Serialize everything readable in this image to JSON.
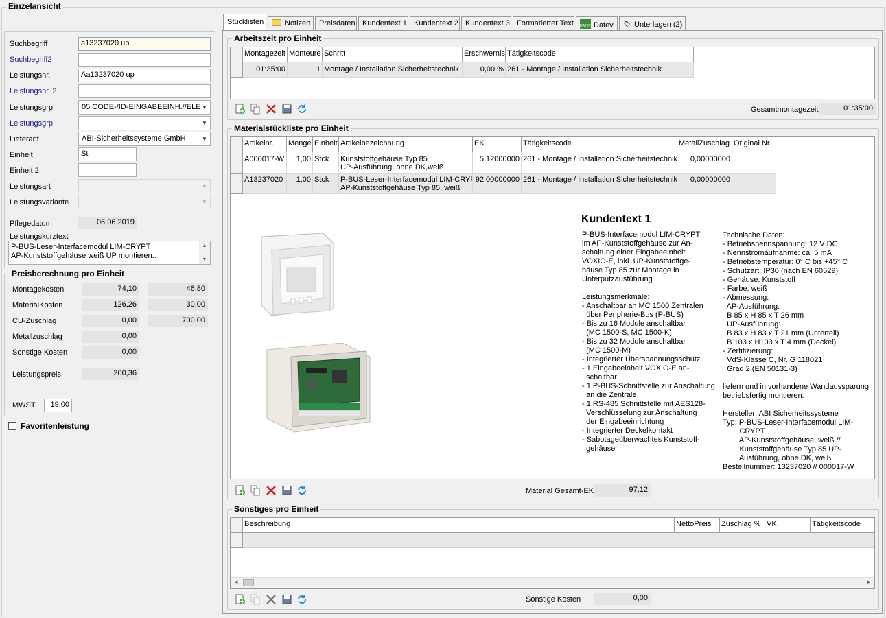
{
  "window": {
    "group_title": "Einzelansicht"
  },
  "form": {
    "suchbegriff_label": "Suchbegriff",
    "suchbegriff_value": "a13237020 up",
    "suchbegriff2_label": "Suchbegriff2",
    "suchbegriff2_value": "",
    "leistungsnr_label": "Leistungsnr.",
    "leistungsnr_value": "Aa13237020 up",
    "leistungsnr2_label": "Leistungsnr. 2",
    "leistungsnr2_value": "",
    "leistungsgrp_label": "Leistungsgrp.",
    "leistungsgrp_value": "05 CODE-/ID-EINGABEEINH.//ELE",
    "leistungsgrp2_label": "Leistungsgrp.",
    "leistungsgrp2_value": "",
    "lieferant_label": "Lieferant",
    "lieferant_value": "ABI-Sicherheitssysteme GmbH",
    "einheit_label": "Einheit",
    "einheit_value": "St",
    "einheit2_label": "Einheit 2",
    "einheit2_value": "",
    "leistungsart_label": "Leistungsart",
    "leistungsart_value": "",
    "leistungsvariante_label": "Leistungsvariante",
    "leistungsvariante_value": "",
    "pflegedatum_label": "Pflegedatum",
    "pflegedatum_value": "06.06.2019",
    "kurztext_label": "Leistungskurztext",
    "kurztext_line1": "P-BUS-Leser-Interfacemodul LIM-CRYPT",
    "kurztext_line2": "AP-Kunststoffgehäuse weiß UP montieren.."
  },
  "preis": {
    "title": "Preisberechnung pro Einheit",
    "montage_label": "Montagekosten",
    "montage_value": "74,10",
    "montage_value2": "46,80",
    "material_label": "MaterialKosten",
    "material_value": "126,26",
    "material_value2": "30,00",
    "cu_label": "CU-Zuschlag",
    "cu_value": "0,00",
    "cu_value2": "700,00",
    "metall_label": "Metallzuschlag",
    "metall_value": "0,00",
    "sonstige_label": "Sonstige Kosten",
    "sonstige_value": "0,00",
    "leistungspreis_label": "Leistungspreis",
    "leistungspreis_value": "200,36",
    "mwst_label": "MWST",
    "mwst_value": "19,00"
  },
  "favoriten_label": "Favoritenleistung",
  "tabs": [
    {
      "label": "Stücklisten"
    },
    {
      "label": "Notizen"
    },
    {
      "label": "Preisdaten"
    },
    {
      "label": "Kundentext 1"
    },
    {
      "label": "Kundentext 2"
    },
    {
      "label": "Kundentext 3"
    },
    {
      "label": "Formatierter Text"
    },
    {
      "label": "Datev"
    },
    {
      "label": "Unterlagen (2)"
    }
  ],
  "arbeitszeit": {
    "title": "Arbeitszeit pro Einheit",
    "headers": [
      "Montagezeit",
      "Monteure",
      "Schritt",
      "Erschwernis",
      "Tätigkeitscode"
    ],
    "row": [
      "01:35:00",
      "1",
      "Montage / Installation Sicherheitstechnik",
      "0,00 %",
      "261 - Montage / Installation Sicherheitstechnik"
    ],
    "gesamt_label": "Gesamtmontagezeit",
    "gesamt_value": "01:35:00"
  },
  "material": {
    "title": "Materialstückliste pro Einheit",
    "headers": [
      "Artikelnr.",
      "Menge",
      "Einheit",
      "Artikelbezeichnung",
      "EK",
      "Tätigkeitscode",
      "MetallZuschlag",
      "Original Nr."
    ],
    "rows": [
      {
        "artnr": "A000017-W",
        "menge": "1,00",
        "einheit": "Stck",
        "bez1": "Kunststoffgehäuse Typ 85",
        "bez2": "UP-Ausführung, ohne DK,weiß",
        "ek": "5,12000000",
        "code": "261 - Montage / Installation Sicherheitstechnik",
        "metall": "0,00000000",
        "orig": ""
      },
      {
        "artnr": "A13237020",
        "menge": "1,00",
        "einheit": "Stck",
        "bez1": "P-BUS-Leser-Interfacemodul LIM-CRYPT",
        "bez2": "AP-Kunststoffgehäuse Typ 85, weiß",
        "ek": "92,00000000",
        "code": "261 - Montage / Installation Sicherheitstechnik",
        "metall": "0,00000000",
        "orig": ""
      }
    ],
    "gesamt_label": "Material Gesamt-EK",
    "gesamt_value": "97,12"
  },
  "kundentext": {
    "heading": "Kundentext 1",
    "col1": [
      "P-BUS-Interfacemodul LIM-CRYPT",
      "im AP-Kunststoffgehäuse zur An-",
      "schaltung einer Eingabeeinheit",
      "VOXIO-E, inkl. UP-Kunststoffge-",
      "häuse Typ 85 zur Montage in",
      "Unterputzausführung",
      "",
      "Leistungsmerkmale:",
      "- Anschaltbar an MC 1500 Zentralen",
      "  über Peripherie-Bus (P-BUS)",
      "- Bis zu 16 Module anschaltbar",
      "  (MC 1500-S, MC 1500-K)",
      "- Bis zu 32 Module anschaltbar",
      "  (MC 1500-M)",
      "- Integrierter Überspannungsschutz",
      "- 1 Eingabeeinheit VOXIO-E an-",
      "  schaltbar",
      "- 1 P-BUS-Schnittstelle zur Anschaltung",
      "  an die Zentrale",
      "- 1 RS-485 Schnittstelle mit AES128-",
      "  Verschlüsselung zur Anschaltung",
      "  der Eingabeeinrichtung",
      "- Integrierter Deckelkontakt",
      "- Sabotageüberwachtes Kunststoff-",
      "  gehäuse"
    ],
    "col2": [
      "Technische Daten:",
      "- Betriebsnennspannung: 12 V DC",
      "- Nennstromaufnahme: ca. 5 mA",
      "- Betriebstemperatur: 0° C bis +45° C",
      "- Schutzart: IP30 (nach EN 60529)",
      "- Gehäuse: Kunststoff",
      "- Farbe: weiß",
      "- Abmessung:",
      "  AP-Ausführung:",
      "  B 85 x H 85 x T 26 mm",
      "  UP-Ausführung:",
      "  B 83 x H 83 x T 21 mm (Unterteil)",
      "  B 103 x H103 x T 4 mm (Deckel)",
      "- Zertifizierung:",
      "  VdS-Klasse C, Nr. G 118021",
      "  Grad 2 (EN 50131-3)",
      "",
      "liefern und in vorhandene Wandaussparung",
      "betriebsfertig montieren.",
      "",
      "Hersteller: ABI Sicherheitssysteme",
      "Typ: P-BUS-Leser-Interfacemodul LIM-",
      "        CRYPT",
      "        AP-Kunststoffgehäuse, weiß //",
      "        Kunststoffgehäuse Typ 85 UP-",
      "        Ausführung, ohne DK, weiß",
      "Bestellnummer: 13237020 // 000017-W"
    ]
  },
  "sonstiges": {
    "title": "Sonstiges pro Einheit",
    "headers": [
      "Beschreibung",
      "NettoPreis",
      "Zuschlag %",
      "VK",
      "Tätigkeitscode"
    ],
    "kosten_label": "Sonstige Kosten",
    "kosten_value": "0,00"
  },
  "colors": {
    "accent": "#1c1c8c",
    "selected_row": "#e8e8e8",
    "input_focus": "#fffde8"
  }
}
